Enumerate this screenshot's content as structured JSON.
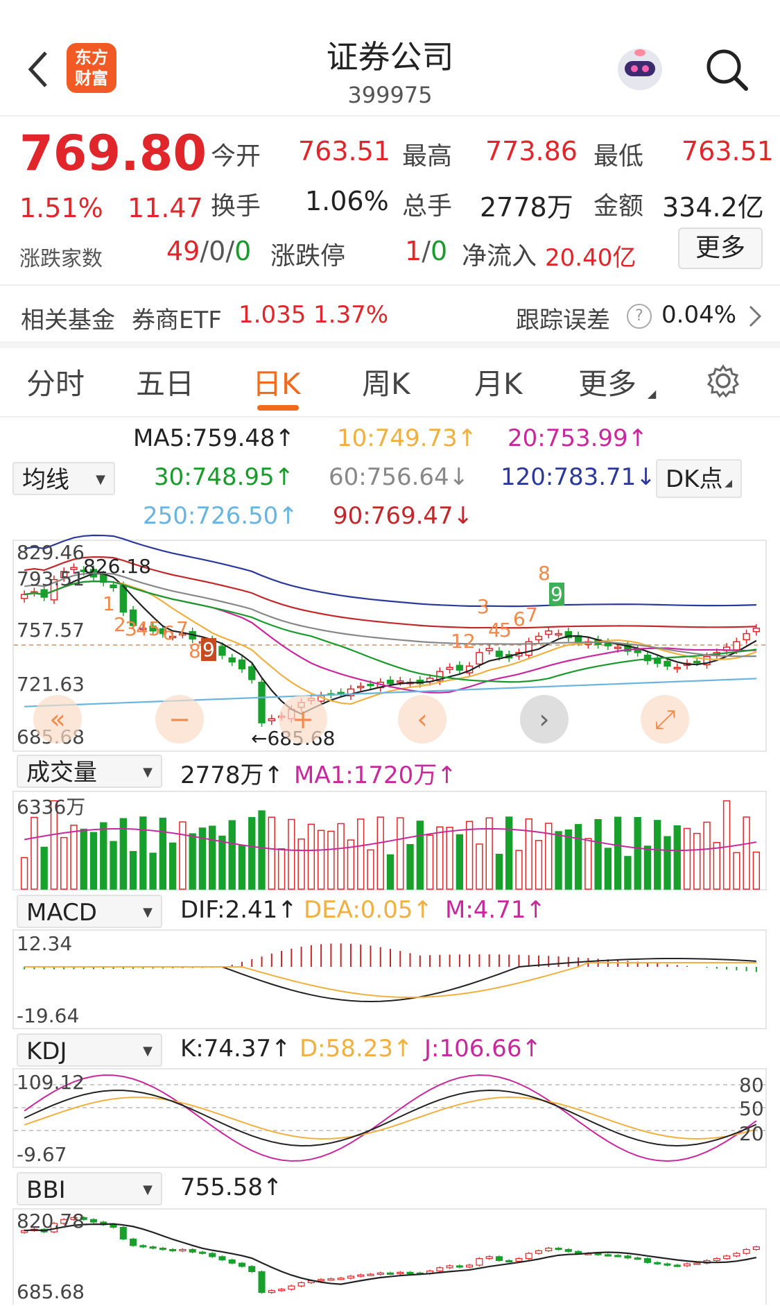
{
  "header": {
    "title": "证券公司",
    "code": "399975",
    "logo_line1": "东方",
    "logo_line2": "财富"
  },
  "quote": {
    "price": "769.80",
    "change_pct": "1.51%",
    "change": "11.47",
    "open_label": "今开",
    "open": "763.51",
    "high_label": "最高",
    "high": "773.86",
    "low_label": "最低",
    "low": "763.51",
    "turnover_label": "换手",
    "turnover": "1.06%",
    "volume_label": "总手",
    "volume": "2778万",
    "amount_label": "金额",
    "amount": "334.2亿",
    "breadth_label": "涨跌家数",
    "breadth_up": "49",
    "breadth_sep1": "/",
    "breadth_flat": "0",
    "breadth_sep2": "/",
    "breadth_down": "0",
    "limit_label": "涨跌停",
    "limit_up": "1",
    "limit_sep": "/",
    "limit_down": "0",
    "netflow_label": "净流入",
    "netflow": "20.40亿",
    "more_btn": "更多"
  },
  "fund": {
    "label": "相关基金",
    "name": "券商ETF",
    "price": "1.035",
    "pct": "1.37%",
    "track_label": "跟踪误差",
    "track_value": "0.04%"
  },
  "tabs": [
    {
      "label": "分时"
    },
    {
      "label": "五日"
    },
    {
      "label": "日K"
    },
    {
      "label": "周K"
    },
    {
      "label": "月K"
    },
    {
      "label": "更多"
    }
  ],
  "ma": {
    "dropdown": "均线",
    "ma5": "MA5:759.48↑",
    "ma10": "10:749.73↑",
    "ma20": "20:753.99↑",
    "ma30": "30:748.95↑",
    "ma60": "60:756.64↓",
    "ma120": "120:783.71↓",
    "ma250": "250:726.50↑",
    "ma90": "90:769.47↓",
    "dk_btn": "DK点",
    "colors": {
      "ma5": "#222222",
      "ma10": "#f0b040",
      "ma20": "#c8289c",
      "ma30": "#1a9a2c",
      "ma60": "#888888",
      "ma120": "#2b3a9a",
      "ma250": "#6ab4e0",
      "ma90": "#c0282c"
    }
  },
  "kline": {
    "y_labels": [
      "829.46",
      "793.51",
      "757.57",
      "721.63",
      "685.68"
    ],
    "hi_label": "826.18",
    "lo_label": "←685.68",
    "nav": [
      "«",
      "−",
      "+",
      "‹",
      "›",
      "⤢"
    ],
    "signals": [
      "1",
      "2",
      "3",
      "4",
      "5",
      "6",
      "7",
      "8",
      "9",
      "1",
      "2",
      "3",
      "4",
      "5",
      "6",
      "7",
      "8",
      "9"
    ]
  },
  "volume": {
    "dropdown": "成交量",
    "value": "2778万↑",
    "ma1": "MA1:1720万↑",
    "y_label": "6336万"
  },
  "macd": {
    "dropdown": "MACD",
    "dif": "DIF:2.41↑",
    "dea": "DEA:0.05↑",
    "m": "M:4.71↑",
    "y_top": "12.34",
    "y_bottom": "-19.64"
  },
  "kdj": {
    "dropdown": "KDJ",
    "k": "K:74.37↑",
    "d": "D:58.23↑",
    "j": "J:106.66↑",
    "y_top": "109.12",
    "y_bottom": "-9.67",
    "levels": [
      "80",
      "50",
      "20"
    ]
  },
  "bbi": {
    "dropdown": "BBI",
    "value": "755.58↑",
    "y_top": "820.78",
    "y_bottom": "685.68"
  },
  "chart_data": {
    "type": "candlestick",
    "ylim": [
      685.68,
      829.46
    ],
    "closes": [
      795,
      797,
      793,
      806,
      812,
      815,
      812,
      808,
      804,
      800,
      782,
      772,
      770,
      768,
      766,
      764,
      766,
      762,
      760,
      755,
      750,
      745,
      740,
      732,
      700,
      703,
      705,
      710,
      715,
      718,
      720,
      721,
      722,
      725,
      727,
      728,
      730,
      729,
      731,
      730,
      729,
      733,
      738,
      741,
      739,
      742,
      752,
      755,
      749,
      748,
      752,
      760,
      764,
      768,
      766,
      763,
      760,
      760,
      758,
      757,
      756,
      753,
      752,
      746,
      744,
      742,
      741,
      744,
      745,
      749,
      752,
      756,
      760,
      766,
      770
    ]
  }
}
